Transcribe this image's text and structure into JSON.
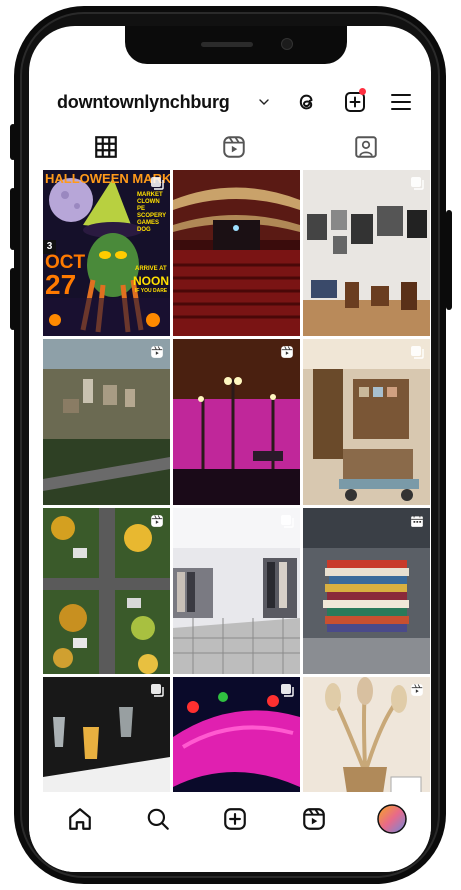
{
  "profile": {
    "username": "downtownlynchburg"
  },
  "header_icons": [
    "threads-icon",
    "create-post-icon",
    "menu-icon"
  ],
  "tabs": [
    "grid-icon",
    "reels-icon",
    "tagged-icon"
  ],
  "grid": {
    "posts": [
      {
        "name": "post-halloween-market",
        "type": "carousel",
        "overlay_text": {
          "title": "HALLOWEEN MARKE",
          "month": "OCT",
          "day": "27",
          "side_lines": [
            "MARKET",
            "CLOWN PE",
            "SCOPERY",
            "GAMES",
            "DOG"
          ],
          "badge": "3",
          "right_top": "ARRIVE AT",
          "right_noon": "NOON",
          "right_sub": "IF YOU DARE"
        }
      },
      {
        "name": "post-theater-interior",
        "type": "none"
      },
      {
        "name": "post-photo-gallery",
        "type": "carousel"
      },
      {
        "name": "post-city-aerial",
        "type": "reel"
      },
      {
        "name": "post-pink-venue",
        "type": "reel"
      },
      {
        "name": "post-antique-shop",
        "type": "carousel"
      },
      {
        "name": "post-autumn-street-aerial",
        "type": "reel"
      },
      {
        "name": "post-clothing-boutique",
        "type": "carousel"
      },
      {
        "name": "post-book-stack",
        "type": "calendar"
      },
      {
        "name": "post-dining-table",
        "type": "carousel"
      },
      {
        "name": "post-light-display",
        "type": "carousel"
      },
      {
        "name": "post-dried-flowers",
        "type": "reel"
      }
    ]
  },
  "bottom_nav": [
    "home-icon",
    "search-icon",
    "create-icon",
    "reels-icon",
    "profile-avatar"
  ]
}
